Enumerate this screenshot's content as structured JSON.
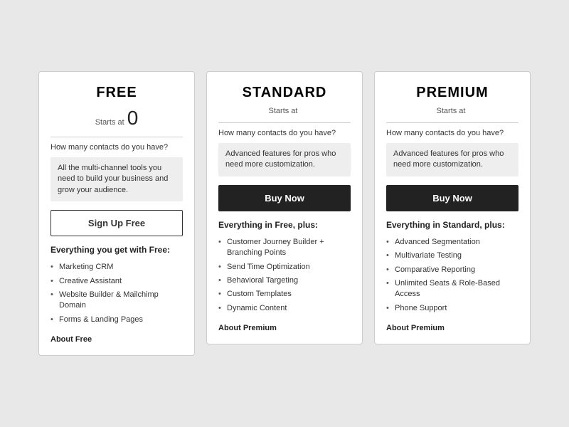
{
  "plans": [
    {
      "id": "free",
      "title": "Free",
      "starts_at_label": "Starts at",
      "price": "0",
      "contacts_question": "How many contacts do you have?",
      "description": "All the multi-channel tools you need to build your business and grow your audience.",
      "cta_label": "Sign Up Free",
      "cta_type": "outline",
      "everything_label": "Everything you get with Free:",
      "features": [
        "Marketing CRM",
        "Creative Assistant",
        "Website Builder & Mailchimp Domain",
        "Forms & Landing Pages"
      ],
      "about_label": "About Free"
    },
    {
      "id": "standard",
      "title": "Standard",
      "starts_at_label": "Starts at",
      "price": "",
      "contacts_question": "How many contacts do you have?",
      "description": "Advanced features for pros who need more customization.",
      "cta_label": "Buy Now",
      "cta_type": "solid",
      "everything_label": "Everything in Free, plus:",
      "features": [
        "Customer Journey Builder + Branching Points",
        "Send Time Optimization",
        "Behavioral Targeting",
        "Custom Templates",
        "Dynamic Content"
      ],
      "about_label": "About Premium"
    },
    {
      "id": "premium",
      "title": "Premium",
      "starts_at_label": "Starts at",
      "price": "",
      "contacts_question": "How many contacts do you have?",
      "description": "Advanced features for pros who need more customization.",
      "cta_label": "Buy Now",
      "cta_type": "solid",
      "everything_label": "Everything in Standard, plus:",
      "features": [
        "Advanced Segmentation",
        "Multivariate Testing",
        "Comparative Reporting",
        "Unlimited Seats & Role-Based Access",
        "Phone Support"
      ],
      "about_label": "About Premium"
    }
  ]
}
